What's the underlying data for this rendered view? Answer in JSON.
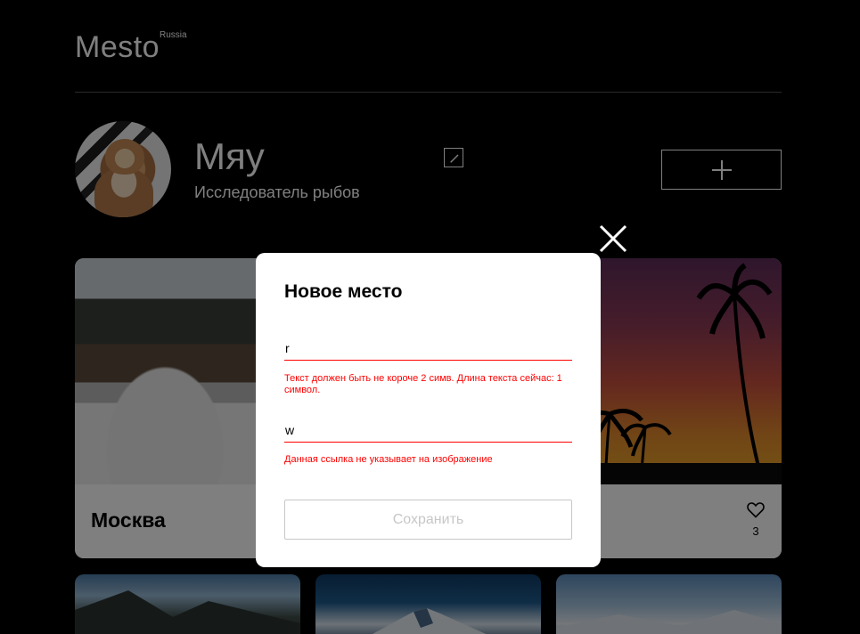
{
  "header": {
    "logo": "Mesto",
    "logo_sup": "Russia"
  },
  "profile": {
    "name": "Мяу",
    "about": "Исследователь рыбов"
  },
  "cards": [
    {
      "title": "Москва",
      "likes": ""
    },
    {
      "title": "",
      "likes": "3"
    }
  ],
  "modal": {
    "title": "Новое место",
    "name_value": "r",
    "name_error": "Текст должен быть не короче 2 симв. Длина текста сейчас: 1 символ.",
    "link_value": "w",
    "link_error": "Данная ссылка не указывает на изображение",
    "submit_label": "Сохранить"
  },
  "colors": {
    "error": "#ff0000",
    "disabled": "#c7c7c7",
    "background": "#000000"
  },
  "icons": [
    "edit-icon",
    "plus-icon",
    "close-icon",
    "heart-icon"
  ]
}
